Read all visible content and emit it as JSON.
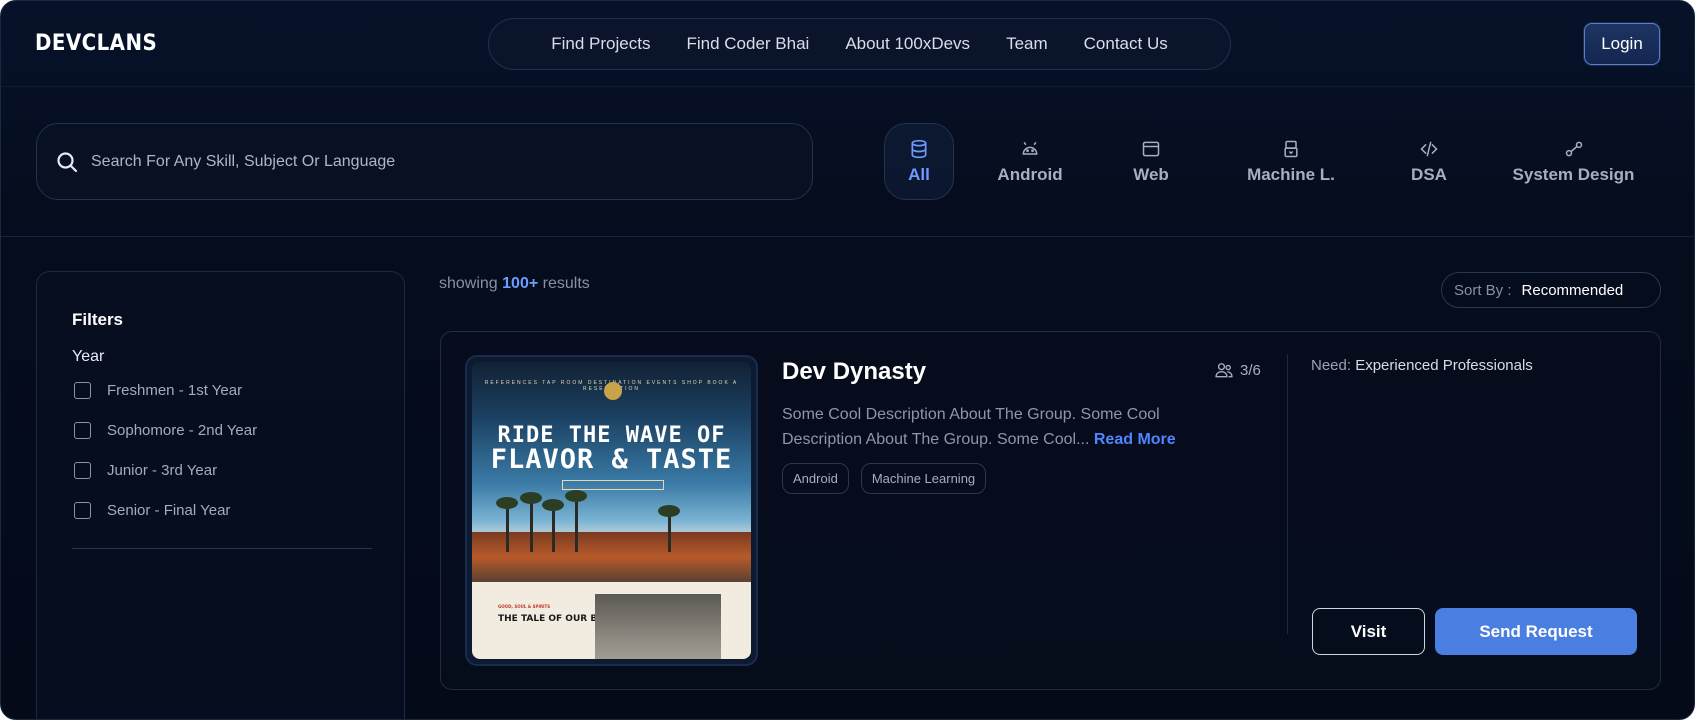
{
  "header": {
    "logo": "DEVCLANS",
    "nav": [
      "Find Projects",
      "Find Coder Bhai",
      "About 100xDevs",
      "Team",
      "Contact Us"
    ],
    "login_label": "Login"
  },
  "search": {
    "placeholder": "Search For Any Skill, Subject Or Language"
  },
  "categories": [
    {
      "label": "All",
      "icon": "database-icon",
      "active": true
    },
    {
      "label": "Android",
      "icon": "android-icon",
      "active": false
    },
    {
      "label": "Web",
      "icon": "browser-window-icon",
      "active": false
    },
    {
      "label": "Machine L.",
      "icon": "robot-icon",
      "active": false
    },
    {
      "label": "DSA",
      "icon": "code-icon",
      "active": false
    },
    {
      "label": "System Design",
      "icon": "nodes-icon",
      "active": false
    }
  ],
  "filters": {
    "title": "Filters",
    "year_label": "Year",
    "options": [
      "Freshmen - 1st Year",
      "Sophomore - 2nd Year",
      "Junior - 3rd Year",
      "Senior - Final Year"
    ]
  },
  "results": {
    "prefix": "showing",
    "count": "100+",
    "suffix": "results",
    "sort_label": "Sort By :",
    "sort_value": "Recommended"
  },
  "card": {
    "title": "Dev Dynasty",
    "members": "3/6",
    "description": "Some Cool Description About The Group. Some Cool Description About The Group. Some Cool...",
    "read_more": "Read More",
    "tags": [
      "Android",
      "Machine Learning"
    ],
    "need_label": "Need:",
    "need_value": "Experienced Professionals",
    "visit_label": "Visit",
    "send_label": "Send Request",
    "thumbnail": {
      "menu": "REFERENCES   TAP ROOM   DESTINATION   EVENTS   SHOP   BOOK A RESERVATION",
      "line1": "RIDE THE WAVE OF",
      "line2": "FLAVOR & TASTE",
      "section_tag": "GOOD, SOUL & SPIRITS",
      "section_title": "THE TALE OF OUR BREWERY"
    }
  },
  "colors": {
    "accent": "#4f86ff",
    "button": "#4a7ee0",
    "background": "#050c1d"
  }
}
